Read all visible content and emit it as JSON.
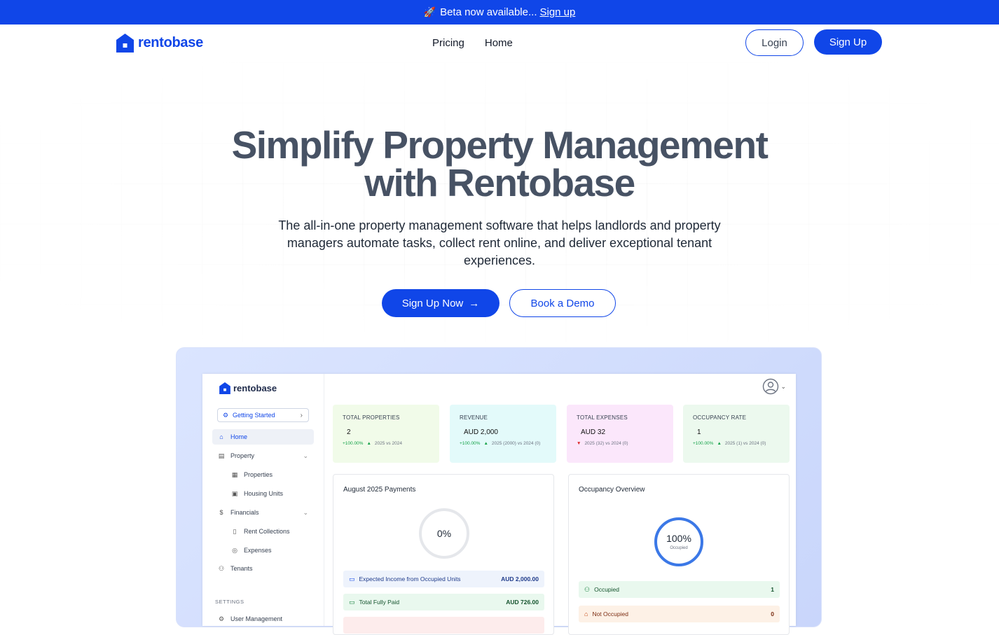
{
  "banner": {
    "rocket": "🚀",
    "text": "Beta now available...",
    "link": "Sign up"
  },
  "nav": {
    "brand": "rentobase",
    "links": [
      "Pricing",
      "Home"
    ],
    "login": "Login",
    "signup": "Sign Up"
  },
  "hero": {
    "title_line1": "Simplify Property Management",
    "title_line2": "with Rentobase",
    "subtitle": "The all-in-one property management software that helps landlords and property managers automate tasks, collect rent online, and deliver exceptional tenant experiences.",
    "cta_primary": "Sign Up Now",
    "cta_primary_arrow": "→",
    "cta_secondary": "Book a Demo"
  },
  "app": {
    "brand": "rentobase",
    "getting_started": "Getting Started",
    "sidebar": {
      "home": "Home",
      "property": "Property",
      "properties": "Properties",
      "housing_units": "Housing Units",
      "financials": "Financials",
      "rent_collections": "Rent Collections",
      "expenses": "Expenses",
      "tenants": "Tenants",
      "settings_section": "SETTINGS",
      "user_management": "User Management"
    },
    "cards": {
      "properties": {
        "label": "TOTAL PROPERTIES",
        "value": "2",
        "change": "+100.00%",
        "compare": "2025 vs 2024"
      },
      "revenue": {
        "label": "REVENUE",
        "value": "AUD 2,000",
        "change": "+100.00%",
        "compare": "2025 (2000) vs 2024 (0)"
      },
      "expenses": {
        "label": "TOTAL EXPENSES",
        "value": "AUD 32",
        "compare": "2025 (32) vs 2024 (0)"
      },
      "occupancy": {
        "label": "OCCUPANCY RATE",
        "value": "1",
        "change": "+100.00%",
        "compare": "2025 (1) vs 2024 (0)"
      }
    },
    "payments": {
      "title": "August 2025 Payments",
      "percent": "0%",
      "progress": 0,
      "expected_label": "Expected Income from Occupied Units",
      "expected_amount": "AUD 2,000.00",
      "paid_label": "Total Fully Paid",
      "paid_amount": "AUD 726.00"
    },
    "occupancy": {
      "title": "Occupancy Overview",
      "percent": "100%",
      "caption": "Occupied",
      "progress": 1.0,
      "occupied_label": "Occupied",
      "occupied_count": "1",
      "not_occupied_label": "Not Occupied",
      "not_occupied_count": "0"
    }
  },
  "colors": {
    "brand": "#1046e8",
    "heading": "#475264"
  }
}
